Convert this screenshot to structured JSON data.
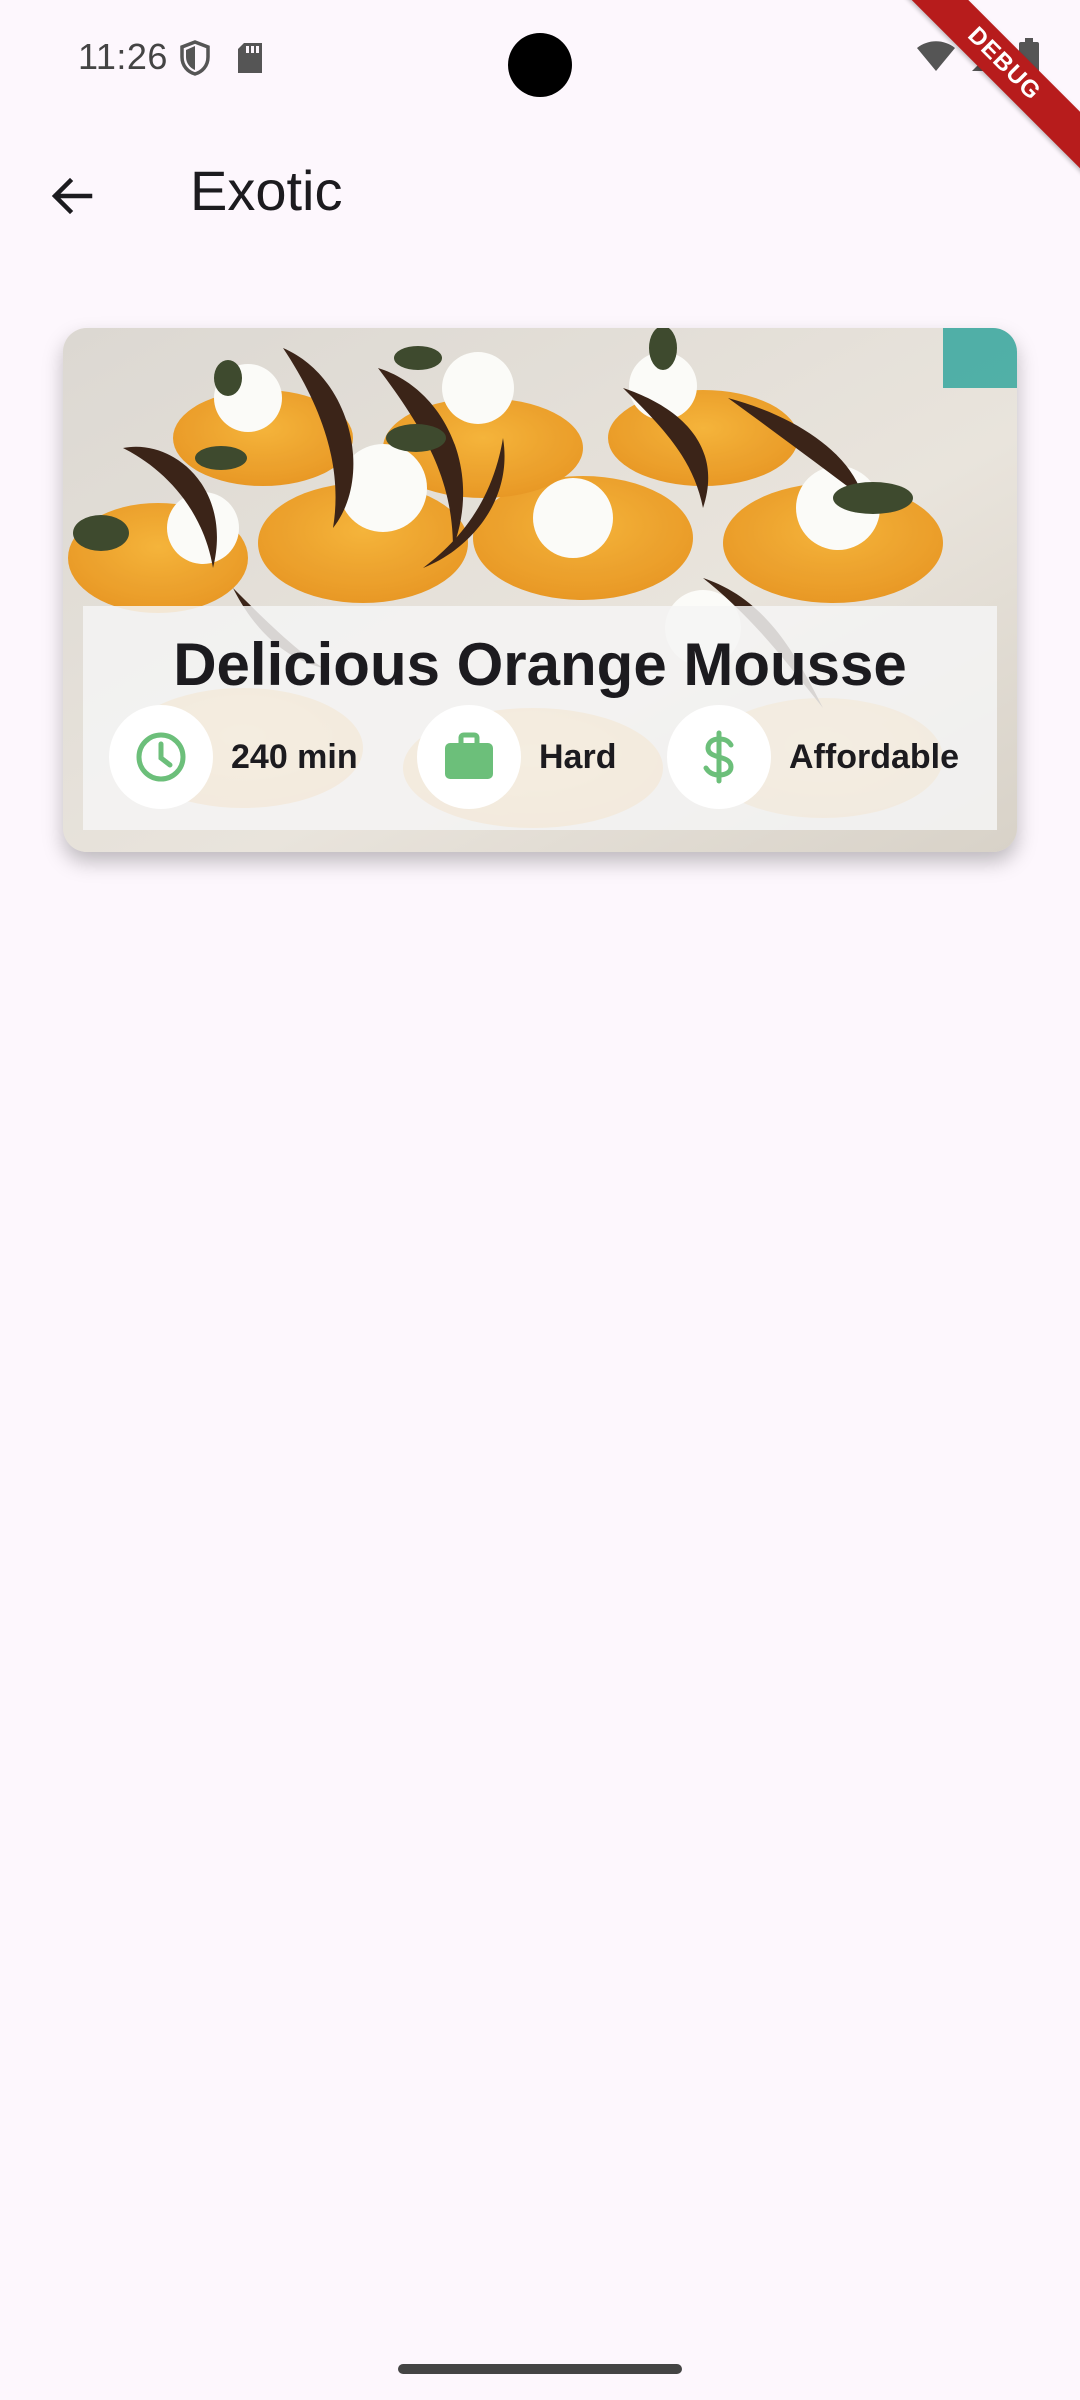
{
  "status_bar": {
    "time": "11:26"
  },
  "debug_banner": {
    "label": "DEBUG"
  },
  "app_bar": {
    "title": "Exotic"
  },
  "meal": {
    "title": "Delicious Orange Mousse",
    "traits": {
      "duration": "240 min",
      "complexity": "Hard",
      "affordability": "Affordable"
    },
    "icon_color": "#6cbf7a",
    "icons": {
      "duration": "clock-icon",
      "complexity": "briefcase-icon",
      "affordability": "dollar-icon"
    }
  }
}
